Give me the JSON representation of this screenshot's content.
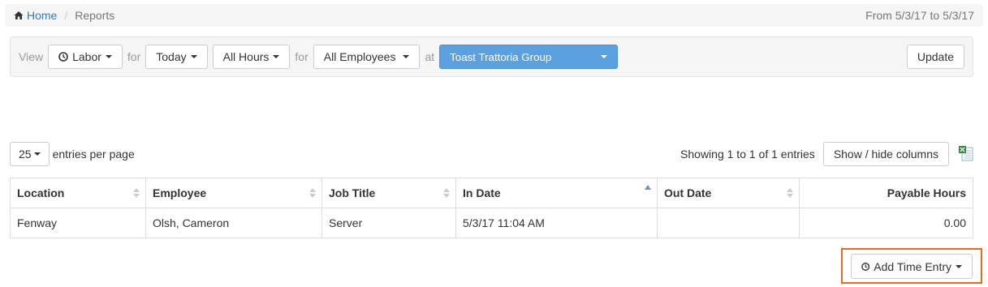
{
  "breadcrumb": {
    "home_label": "Home",
    "separator": "/",
    "current": "Reports",
    "date_range": "From 5/3/17 to 5/3/17"
  },
  "filters": {
    "view_label": "View",
    "report_type": "Labor",
    "for_label_1": "for",
    "period": "Today",
    "hours": "All Hours",
    "for_label_2": "for",
    "employees": "All Employees",
    "at_label": "at",
    "location_group": "Toast Trattoria Group",
    "update_label": "Update"
  },
  "table_controls": {
    "page_size": "25",
    "per_page_label": "entries per page",
    "showing": "Showing 1 to 1 of 1 entries",
    "show_hide_label": "Show / hide columns"
  },
  "table": {
    "columns": [
      "Location",
      "Employee",
      "Job Title",
      "In Date",
      "Out Date",
      "Payable Hours"
    ],
    "rows": [
      [
        "Fenway",
        "Olsh, Cameron",
        "Server",
        "5/3/17 11:04 AM",
        "",
        "0.00"
      ]
    ]
  },
  "actions": {
    "add_time_entry": "Add Time Entry"
  },
  "colors": {
    "link": "#337ab7",
    "primary_dropdown": "#5ba0e0",
    "highlight": "#e86a1c"
  },
  "icons": {
    "home": "home-icon",
    "clock": "clock-icon",
    "excel": "excel-export-icon"
  }
}
